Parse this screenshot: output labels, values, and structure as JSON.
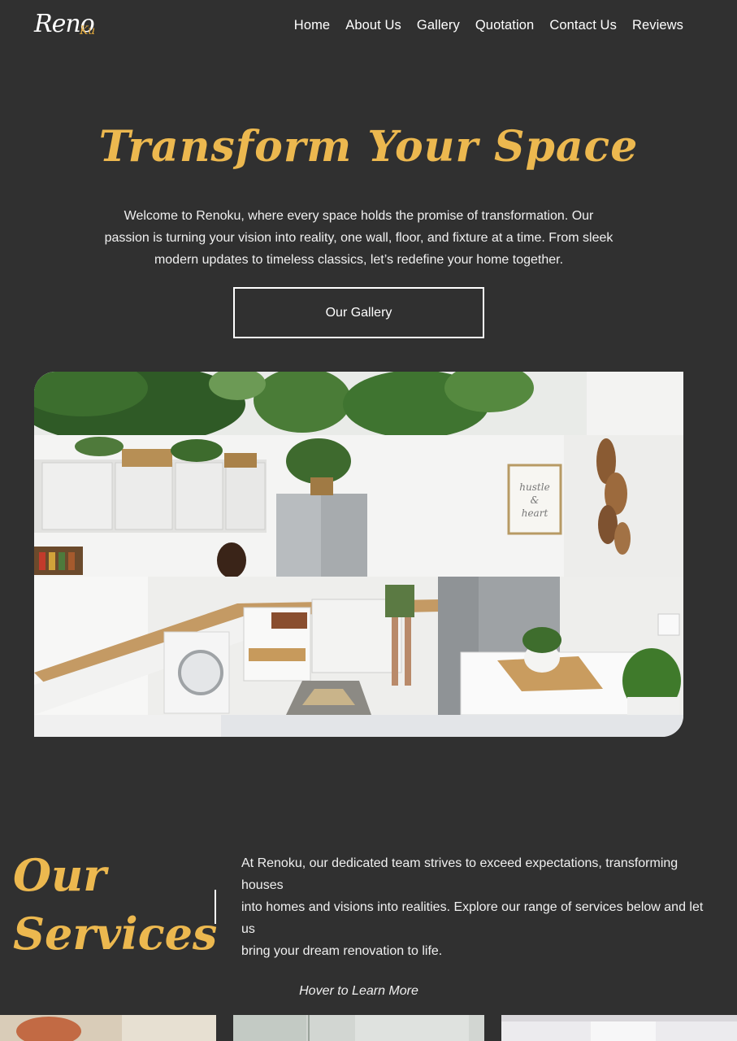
{
  "header": {
    "logo": {
      "main": "Reno",
      "accent": "Ku"
    },
    "nav": [
      "Home",
      "About Us",
      "Gallery",
      "Quotation",
      "Contact Us",
      "Reviews"
    ]
  },
  "hero": {
    "title": "Transform Your Space",
    "description": "Welcome to Renoku, where every space holds the promise of transformation. Our passion is turning your vision into reality, one wall, floor, and fixture at a time. From sleek modern updates to timeless classics, let’s redefine your home together.",
    "button_label": "Our Gallery",
    "image_sign_text": [
      "hustle",
      "&",
      "heart"
    ]
  },
  "services": {
    "title_line1": "Our",
    "title_line2": "Services",
    "lines": [
      "At Renoku, our dedicated team strives to exceed expectations, transforming houses",
      "into homes and visions into realities. Explore our range of services below and let us",
      "bring your dream renovation to life."
    ],
    "hint": "Hover to Learn More"
  },
  "colors": {
    "background": "#303030",
    "accent": "#ecb84f",
    "text": "#ffffff"
  }
}
